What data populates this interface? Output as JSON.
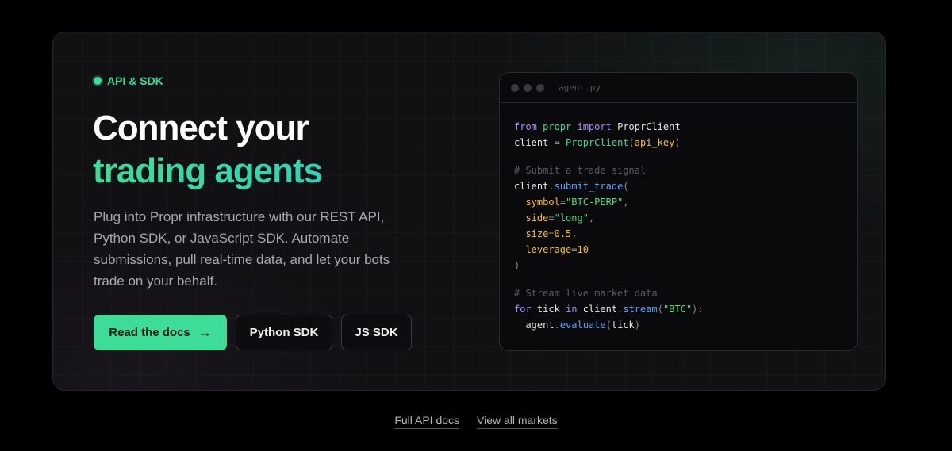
{
  "badge": {
    "label": "API & SDK",
    "dot_color": "#3ddc97"
  },
  "headline": {
    "line1": "Connect your",
    "line2": "trading agents",
    "accent_color": "#3ddc97"
  },
  "description": "Plug into Propr infrastructure with our REST API, Python SDK, or JavaScript SDK. Automate submissions, pull real-time data, and let your bots trade on your behalf.",
  "buttons": {
    "primary_label": "Read the docs",
    "primary_icon": "arrow-right-icon",
    "python_label": "Python SDK",
    "js_label": "JS SDK"
  },
  "code_window": {
    "filename": "agent.py",
    "tokens": {
      "from": "from",
      "propr": "propr",
      "import": "import",
      "ProprClient": "ProprClient",
      "client": "client",
      "eq": " = ",
      "api_key": "api_key",
      "comment1": "# Submit a trade signal",
      "submit_trade": "submit_trade",
      "symbol": "symbol",
      "symbol_val": "\"BTC-PERP\"",
      "side": "side",
      "side_val": "\"long\"",
      "size": "size",
      "size_val": "0.5",
      "leverage": "leverage",
      "leverage_val": "10",
      "comment2": "# Stream live market data",
      "for": "for",
      "tick": "tick",
      "in": "in",
      "stream": "stream",
      "btc": "\"BTC\"",
      "agent": "agent",
      "evaluate": "evaluate"
    }
  },
  "footer": {
    "link1": "Full API docs",
    "link2": "View all markets"
  }
}
